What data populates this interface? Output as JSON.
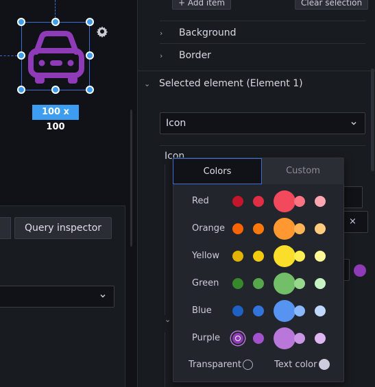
{
  "canvas": {
    "size_badge": "100 x 100",
    "query_inspector_label": "Query inspector",
    "element_icon": "car-icon",
    "settings_icon": "gear-icon"
  },
  "options": {
    "add_item_label": "+ Add item",
    "clear_selection_label": "Clear selection",
    "sections": [
      {
        "label": "Background"
      },
      {
        "label": "Border"
      }
    ],
    "selected_element_title": "Selected element (Element 1)",
    "element_type_value": "Icon",
    "icon_subsection_label": "Icon",
    "close_label": "×"
  },
  "color_picker": {
    "tabs": [
      {
        "label": "Colors",
        "active": true
      },
      {
        "label": "Custom",
        "active": false
      }
    ],
    "rows": [
      {
        "name": "Red",
        "colors": [
          "#c4162a",
          "#e02f44",
          "#f2495c",
          "#ff7383",
          "#ffa6b0"
        ]
      },
      {
        "name": "Orange",
        "colors": [
          "#fa6400",
          "#ff780a",
          "#ff9830",
          "#ffb357",
          "#ffcb7d"
        ]
      },
      {
        "name": "Yellow",
        "colors": [
          "#e0b400",
          "#f2cc0c",
          "#fade2a",
          "#ffee52",
          "#fff899"
        ]
      },
      {
        "name": "Green",
        "colors": [
          "#37872d",
          "#56a64b",
          "#73bf69",
          "#96d98d",
          "#c8f2c2"
        ]
      },
      {
        "name": "Blue",
        "colors": [
          "#1f60c4",
          "#3274d9",
          "#5794f2",
          "#8ab8ff",
          "#c0d8ff"
        ]
      },
      {
        "name": "Purple",
        "colors": [
          "#8f3bb8",
          "#a352cc",
          "#b877d9",
          "#ca95e5",
          "#deb6f2"
        ]
      }
    ],
    "selected_color": "#8f3bb8",
    "transparent_label": "Transparent",
    "text_color_label": "Text color"
  },
  "colors": {
    "accent_blue": "#3d9df0",
    "icon_purple": "#8f3bb8"
  }
}
